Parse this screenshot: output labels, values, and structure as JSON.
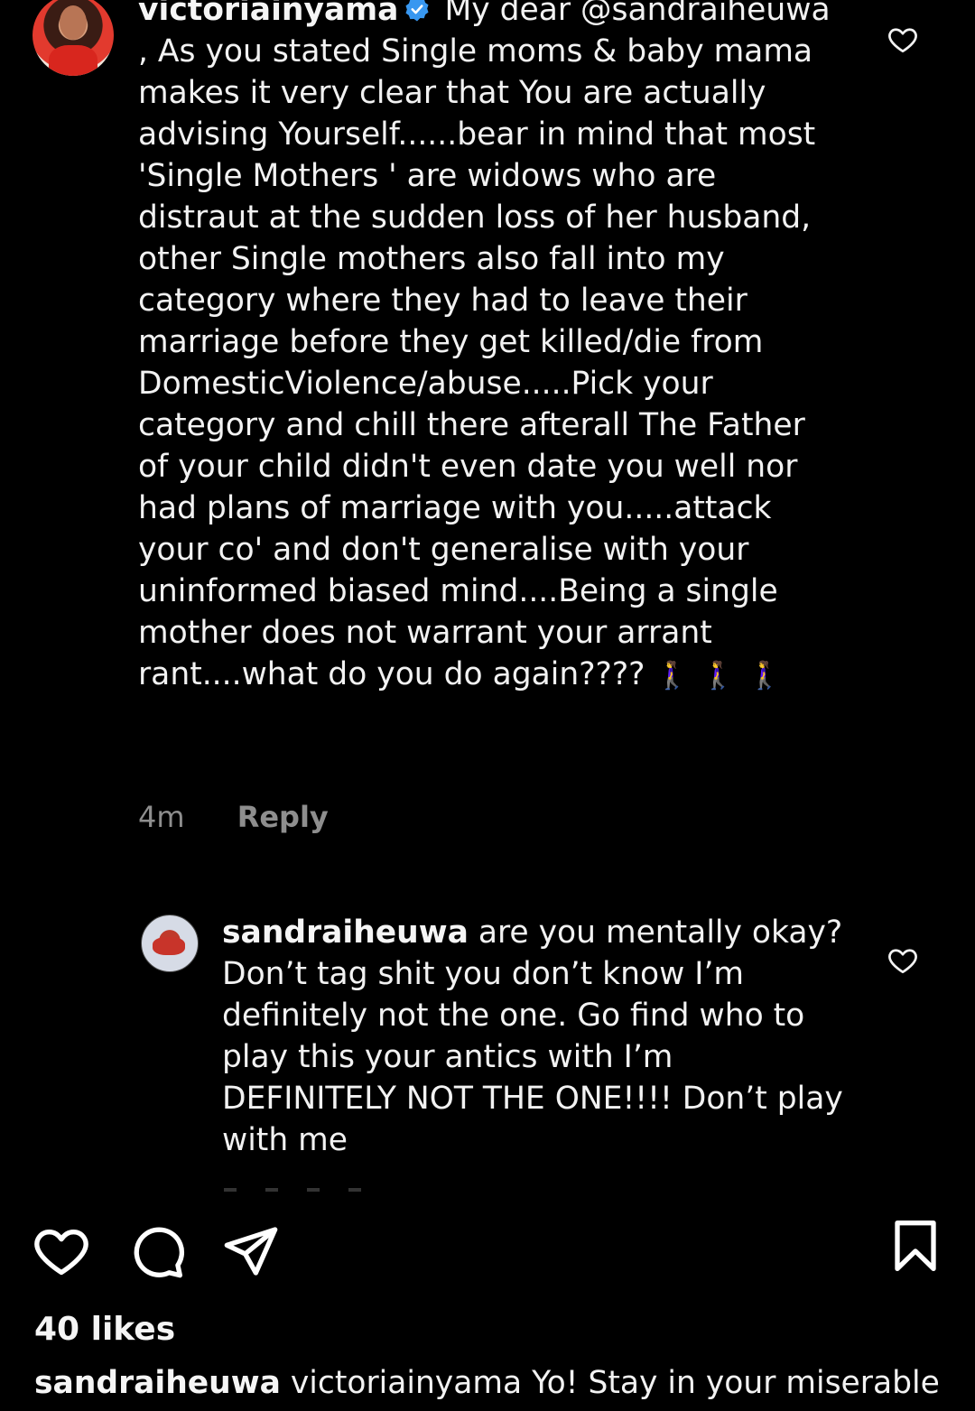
{
  "comment_main": {
    "username": "victoriainyama",
    "verified_icon": "verified-badge-icon",
    "text": "My dear @sandraiheuwa , As you stated Single moms & baby mama makes it very clear that You are actually advising Yourself......bear in mind that most 'Single Mothers ' are widows who are distraut at the sudden loss  of her husband, other Single mothers also fall into my category where they had to leave their marriage before they get killed/die from DomesticViolence/abuse.....Pick your category and chill there afterall The Father of your child didn't even date you well nor had plans of marriage with you.....attack your co' and don't generalise with your uninformed biased mind....Being a single mother does not warrant your arrant rant....what do you do again????",
    "emoji": "🚶‍♀️🚶‍♀️🚶‍♀️",
    "time": "4m",
    "reply_label": "Reply",
    "like_icon": "heart-outline-icon"
  },
  "comment_reply": {
    "username": "sandraiheuwa",
    "text": "are you mentally okay? Don’t tag shit you don’t know I’m definitely not the one. Go find who to play this your antics with I’m DEFINITELY NOT THE ONE!!!! Don’t play with me",
    "like_icon": "heart-outline-icon"
  },
  "actions": {
    "like": "heart-icon",
    "comment": "comment-bubble-icon",
    "share": "paper-plane-icon",
    "save": "bookmark-icon"
  },
  "post": {
    "likes": "40 likes",
    "caption_username": "sandraiheuwa",
    "caption_text": "victoriainyama Yo! Stay in your miserable"
  },
  "colors": {
    "background": "#000000",
    "text": "#f2f2f2",
    "muted": "#8e8e8e",
    "verified": "#3897f0"
  }
}
